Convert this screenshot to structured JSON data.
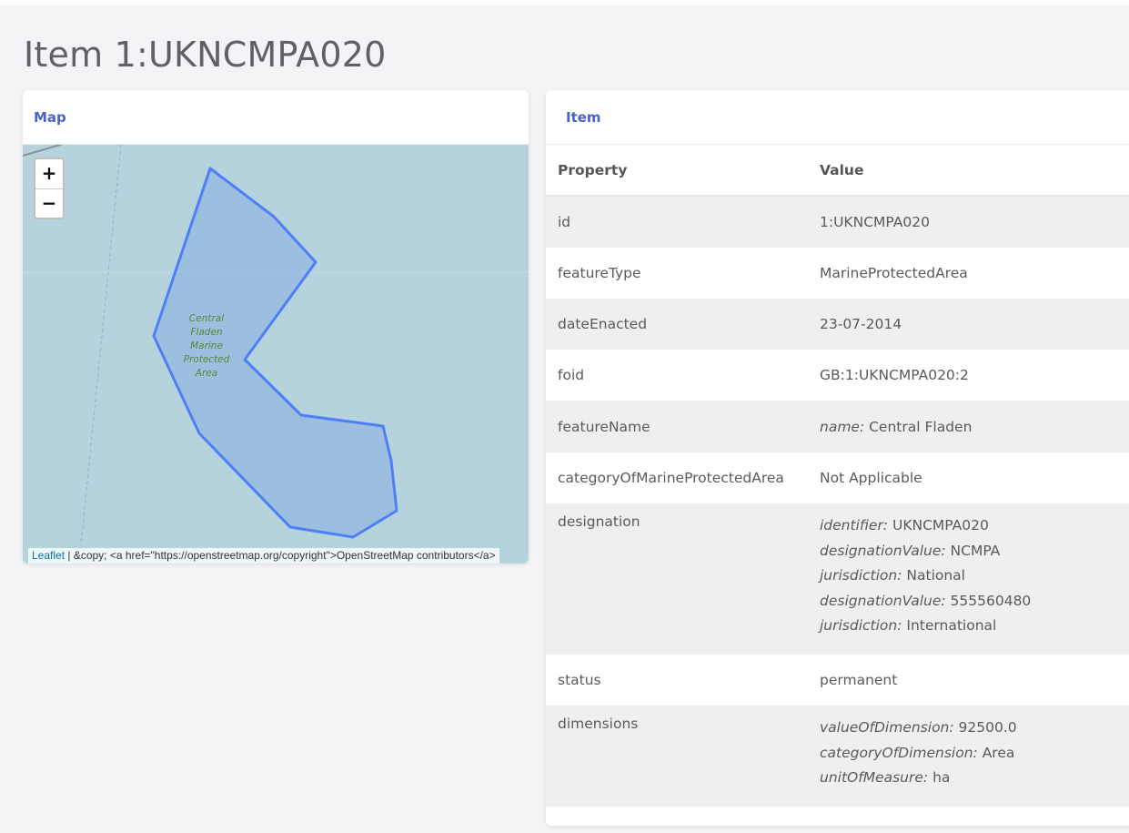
{
  "page": {
    "title": "Item 1:UKNCMPA020"
  },
  "map_card": {
    "title": "Map",
    "zoom_in": "+",
    "zoom_out": "−",
    "area_label": [
      "Central",
      "Fladen",
      "Marine",
      "Protected",
      "Area"
    ],
    "attribution_link": "Leaflet",
    "attribution_text": " | &copy; <a href=\"https://openstreetmap.org/copyright\">OpenStreetMap contributors</a>",
    "colors": {
      "water": "#b5d3dc",
      "polygon_stroke": "#4f7ff7",
      "polygon_fill": "#7ea6e4",
      "label": "#4f8c3a"
    }
  },
  "item_card": {
    "title": "Item",
    "header": {
      "property": "Property",
      "value": "Value"
    },
    "rows": [
      {
        "key": "id",
        "value": "1:UKNCMPA020"
      },
      {
        "key": "featureType",
        "value": "MarineProtectedArea"
      },
      {
        "key": "dateEnacted",
        "value": "23-07-2014"
      },
      {
        "key": "foid",
        "value": "GB:1:UKNCMPA020:2"
      },
      {
        "key": "featureName",
        "label": "name:",
        "value": " Central Fladen"
      },
      {
        "key": "categoryOfMarineProtectedArea",
        "value": "Not Applicable"
      },
      {
        "key": "designation",
        "lines": [
          {
            "label": "identifier:",
            "value": " UKNCMPA020"
          },
          {
            "label": "designationValue:",
            "value": " NCMPA"
          },
          {
            "label": "jurisdiction:",
            "value": " National"
          },
          {
            "label": "designationValue:",
            "value": " 555560480"
          },
          {
            "label": "jurisdiction:",
            "value": " International"
          }
        ]
      },
      {
        "key": "status",
        "value": "permanent"
      },
      {
        "key": "dimensions",
        "lines": [
          {
            "label": "valueOfDimension:",
            "value": " 92500.0"
          },
          {
            "label": "categoryOfDimension:",
            "value": " Area"
          },
          {
            "label": "unitOfMeasure:",
            "value": " ha"
          }
        ]
      }
    ]
  }
}
